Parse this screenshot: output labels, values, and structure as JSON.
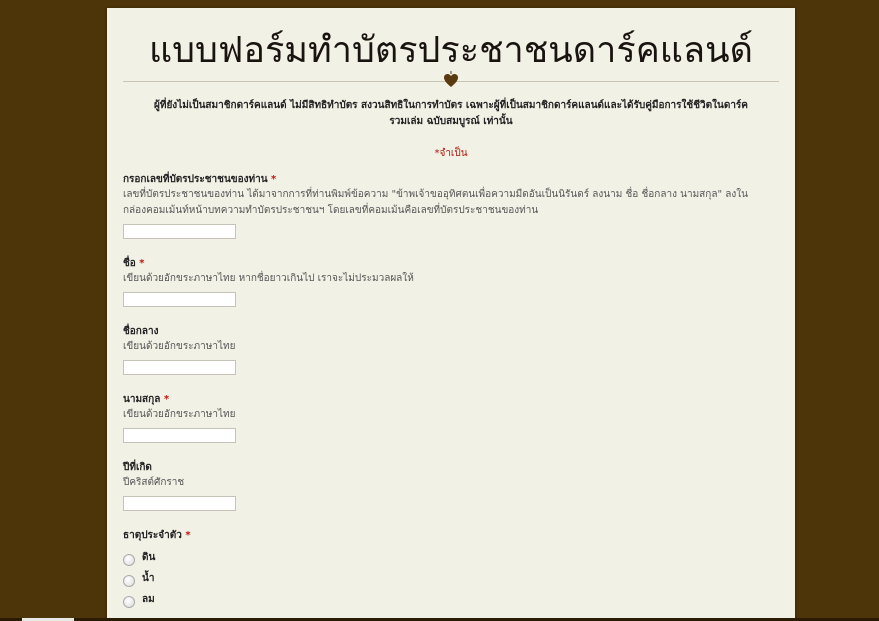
{
  "form": {
    "title": "แบบฟอร์มทำบัตรประชาชนดาร์คแลนด์",
    "description": "ผู้ที่ยังไม่เป็นสมาชิกดาร์คแลนด์ ไม่มีสิทธิทำบัตร สงวนสิทธิในการทำบัตร เฉพาะผู้ที่เป็นสมาชิกดาร์คแลนด์และได้รับคู่มือการใช้ชีวิตในดาร์ครวมเล่ม ฉบับสมบูรณ์ เท่านั้น",
    "required_note": "*จำเป็น",
    "required_star": "*"
  },
  "questions": {
    "id_number": {
      "label": "กรอกเลขที่บัตรประชาชนของท่าน",
      "help": "เลขที่บัตรประชาชนของท่าน ได้มาจากการที่ท่านพิมพ์ข้อความ \"ข้าพเจ้าขออุทิศตนเพื่อความมืดอันเป็นนิรันดร์ ลงนาม ชื่อ ชื่อกลาง นามสกุล\" ลงในกล่องคอมเม้นท์หน้าบทความทำบัตรประชาชนฯ โดยเลขที่คอมเม้นคือเลขที่บัตรประชาชนของท่าน",
      "value": ""
    },
    "first_name": {
      "label": "ชื่อ",
      "help": "เขียนด้วยอักขระภาษาไทย หากชื่อยาวเกินไป เราจะไม่ประมวลผลให้",
      "value": ""
    },
    "middle_name": {
      "label": "ชื่อกลาง",
      "help": "เขียนด้วยอักขระภาษาไทย",
      "value": ""
    },
    "last_name": {
      "label": "นามสกุล",
      "help": "เขียนด้วยอักขระภาษาไทย",
      "value": ""
    },
    "birth_year": {
      "label": "ปีที่เกิด",
      "help": "ปีคริสต์ศักราช",
      "value": ""
    },
    "element": {
      "label": "ธาตุประจำตัว",
      "options": [
        "ดิน",
        "น้ำ",
        "ลม"
      ]
    }
  }
}
